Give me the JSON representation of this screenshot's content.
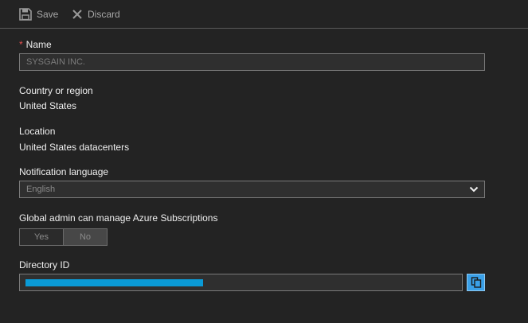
{
  "toolbar": {
    "save_label": "Save",
    "discard_label": "Discard"
  },
  "form": {
    "name": {
      "required_marker": "*",
      "label": "Name",
      "value": "SYSGAIN INC."
    },
    "country": {
      "label": "Country or region",
      "value": "United States"
    },
    "location": {
      "label": "Location",
      "value": "United States datacenters"
    },
    "notification_language": {
      "label": "Notification language",
      "selected": "English"
    },
    "global_admin": {
      "label": "Global admin can manage Azure Subscriptions",
      "options": [
        "Yes",
        "No"
      ],
      "selected": "No"
    },
    "directory_id": {
      "label": "Directory ID"
    }
  },
  "colors": {
    "background": "#232323",
    "accent": "#3aa0e8",
    "redaction": "#0a9ad6",
    "required": "#e85050"
  },
  "icons": {
    "save": "save-icon",
    "discard": "close-icon",
    "dropdown": "chevron-down-icon",
    "copy": "copy-icon"
  }
}
